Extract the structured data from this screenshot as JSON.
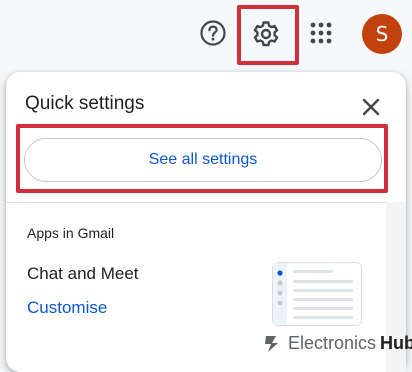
{
  "header": {
    "avatar_initial": "S",
    "icons": {
      "help": "help-circle-icon",
      "settings": "gear-icon",
      "apps": "apps-grid-icon"
    }
  },
  "quick_settings": {
    "title": "Quick settings",
    "see_all_label": "See all settings",
    "section_label": "Apps in Gmail",
    "chat_meet_label": "Chat and Meet",
    "customise_label": "Customise"
  },
  "watermark": {
    "brand": "Electronics",
    "brand_suffix": "Hub"
  },
  "colors": {
    "highlight": "#d32f3a",
    "accent": "#0b57d0",
    "avatar_bg": "#c2410c",
    "background": "#f6f8fc"
  }
}
